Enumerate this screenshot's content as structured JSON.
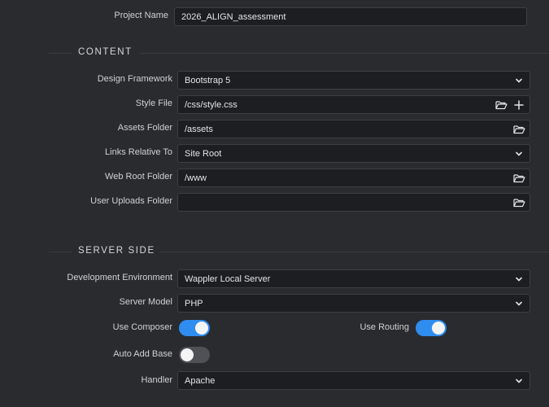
{
  "project": {
    "name_label": "Project Name",
    "name_value": "2026_ALIGN_assessment"
  },
  "content": {
    "section_title": "CONTENT",
    "design_framework": {
      "label": "Design Framework",
      "value": "Bootstrap 5"
    },
    "style_file": {
      "label": "Style File",
      "value": "/css/style.css"
    },
    "assets_folder": {
      "label": "Assets Folder",
      "value": "/assets"
    },
    "links_relative_to": {
      "label": "Links Relative To",
      "value": "Site Root"
    },
    "web_root_folder": {
      "label": "Web Root Folder",
      "value": "/www"
    },
    "user_uploads_folder": {
      "label": "User Uploads Folder",
      "value": ""
    }
  },
  "server_side": {
    "section_title": "SERVER SIDE",
    "development_environment": {
      "label": "Development Environment",
      "value": "Wappler Local Server"
    },
    "server_model": {
      "label": "Server Model",
      "value": "PHP"
    },
    "use_composer": {
      "label": "Use Composer",
      "on": true
    },
    "use_routing": {
      "label": "Use Routing",
      "on": true
    },
    "auto_add_base": {
      "label": "Auto Add Base",
      "on": false
    },
    "handler": {
      "label": "Handler",
      "value": "Apache"
    }
  },
  "colors": {
    "background": "#2a2b2f",
    "field_background": "#1d1e21",
    "accent": "#2f8df0"
  },
  "icons": [
    "chevron-down-icon",
    "folder-open-icon",
    "plus-icon"
  ]
}
